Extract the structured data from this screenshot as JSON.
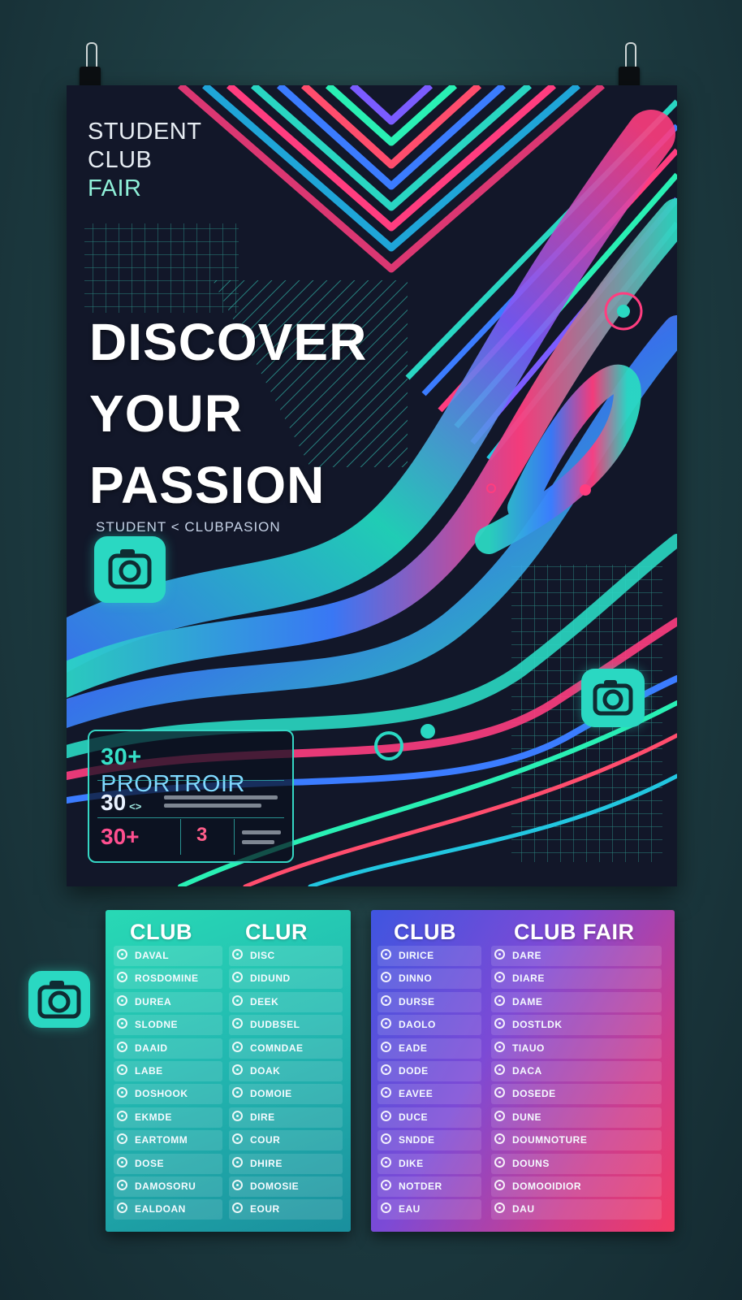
{
  "poster": {
    "kicker": {
      "line1": "STUDENT",
      "line2": "CLUB",
      "line3": "FAIR"
    },
    "headline": {
      "line1": "DISCOVER",
      "line2": "YOUR",
      "line3": "PASSION"
    },
    "tagline": "STUDENT  <  CLUBPASION",
    "stats": {
      "title_num": "30+",
      "title_word": "PRORTROIR",
      "row1": "30",
      "row1_mark": "<>",
      "row2": "30+",
      "row2_small": "3"
    },
    "colors": {
      "teal": "#2ad8c2",
      "pink": "#ff3d7f",
      "blue": "#3b7cff",
      "navy": "#11172a"
    },
    "icons": [
      "camera-icon",
      "camera-icon",
      "target-ring-icon"
    ]
  },
  "cards": {
    "left": {
      "headers": [
        "CLUB",
        "CLUR"
      ],
      "col1": [
        "DAVAL",
        "ROSDOMINE",
        "DUREA",
        "SLODNE",
        "DAAID",
        "LABE",
        "DOSHOOK",
        "EKMDE",
        "EARTOMM",
        "DOSE",
        "DAMOSORU",
        "EALDOAN"
      ],
      "col2": [
        "DISC",
        "DIDUND",
        "DEEK",
        "DUDBSEL",
        "COMNDAE",
        "DOAK",
        "DOMOIE",
        "DIRE",
        "COUR",
        "DHIRE",
        "DOMOSIE",
        "EOUR"
      ]
    },
    "right": {
      "headers": [
        "CLUB",
        "CLUB FAIR"
      ],
      "col1": [
        "DIRICE",
        "DINNO",
        "DURSE",
        "DAOLO",
        "EADE",
        "DODE",
        "EAVEE",
        "DUCE",
        "SNDDE",
        "DIKE",
        "NOTDER",
        "EAU"
      ],
      "col2": [
        "DARE",
        "DIARE",
        "DAME",
        "DOSTLDK",
        "TIAUO",
        "DACA",
        "DOSEDE",
        "DUNE",
        "DOUMNOTURE",
        "DOUNS",
        "DOMOOIDIOR",
        "DAU"
      ]
    }
  }
}
